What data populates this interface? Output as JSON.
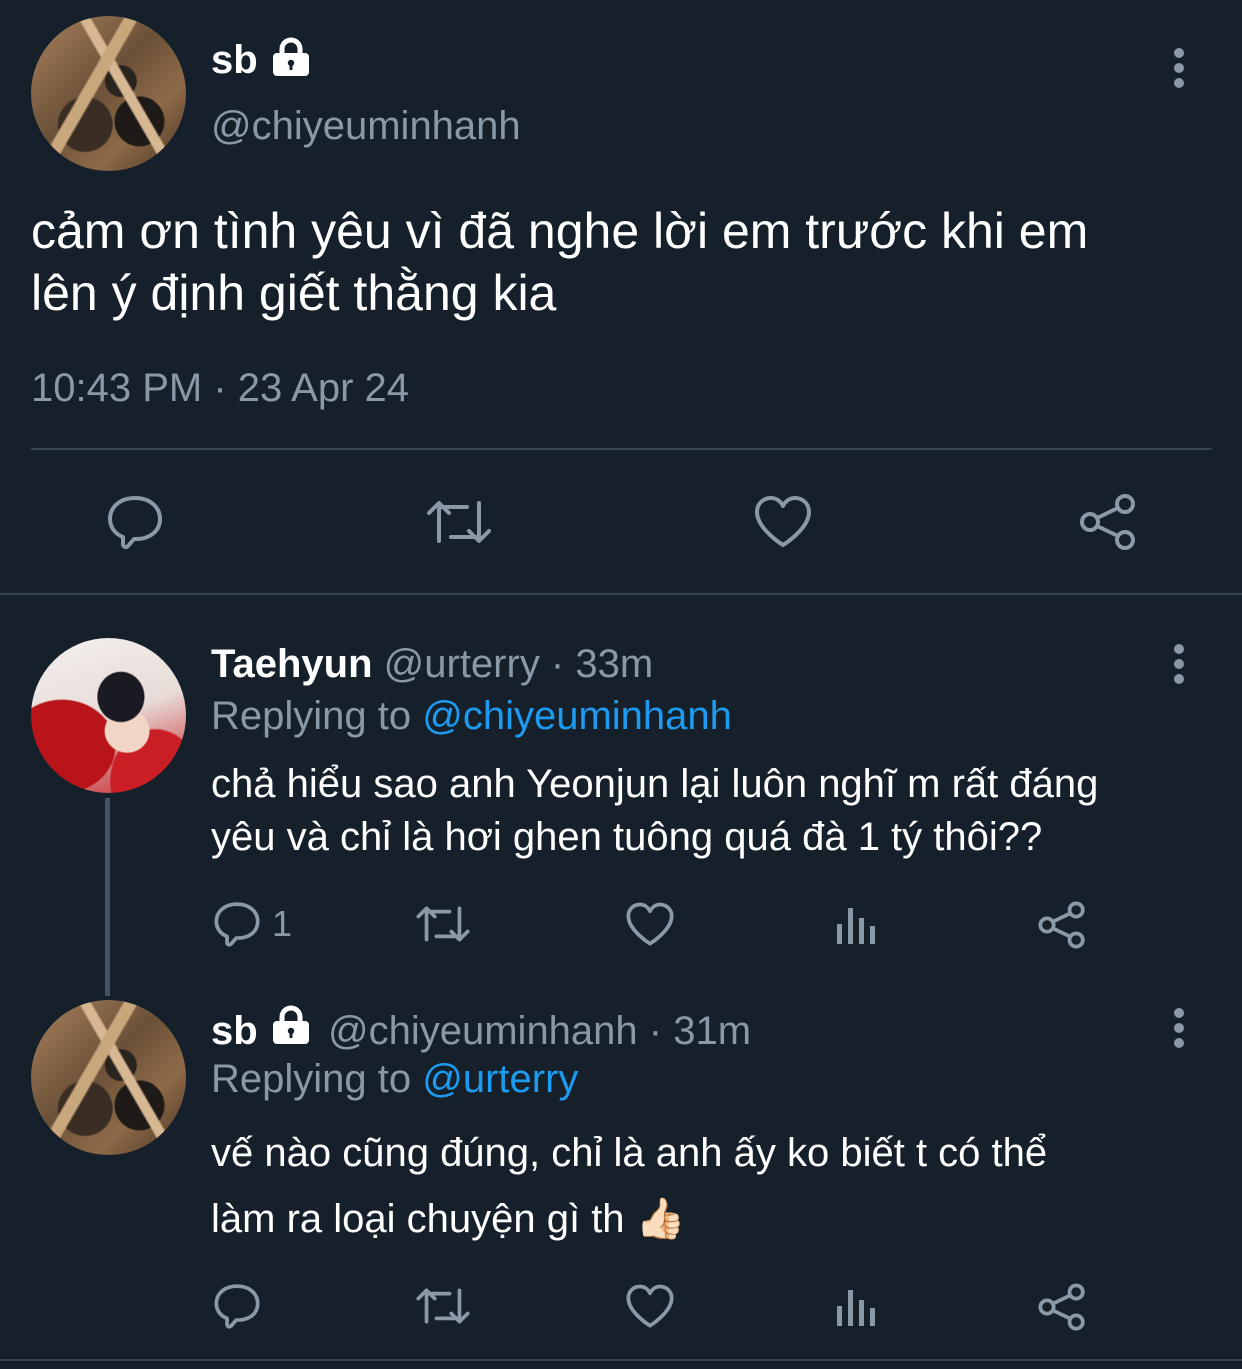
{
  "main_tweet": {
    "display_name": "sb",
    "handle": "@chiyeuminhanh",
    "text_line1": "cảm ơn tình yêu vì đã nghe lời em trước khi em",
    "text_line2": "lên ý định giết thằng kia",
    "timestamp": "10:43 PM · 23 Apr 24"
  },
  "reply1": {
    "display_name": "Taehyun",
    "handle_time": "@urterry · 33m",
    "replying_prefix": "Replying to ",
    "replying_to": "@chiyeuminhanh",
    "text_line1": "chả hiểu sao anh Yeonjun lại luôn nghĩ m rất đáng",
    "text_line2": "yêu và chỉ là hơi ghen tuông quá đà 1 tý thôi??",
    "reply_count": "1"
  },
  "reply2": {
    "display_name": "sb",
    "handle_time": "@chiyeuminhanh · 31m",
    "replying_prefix": "Replying to ",
    "replying_to": "@urterry",
    "text_line1": "vế nào cũng đúng, chỉ là anh ấy ko biết t có thể",
    "text_line2": "làm ra loại chuyện gì th",
    "emoji": "👍🏻"
  },
  "colors": {
    "background": "#15202b",
    "muted": "#8b98a5",
    "link": "#1d9bf0",
    "divider": "#38444d"
  },
  "icons": [
    "lock-icon",
    "more-icon",
    "reply-icon",
    "retweet-icon",
    "like-icon",
    "share-icon",
    "views-icon"
  ]
}
